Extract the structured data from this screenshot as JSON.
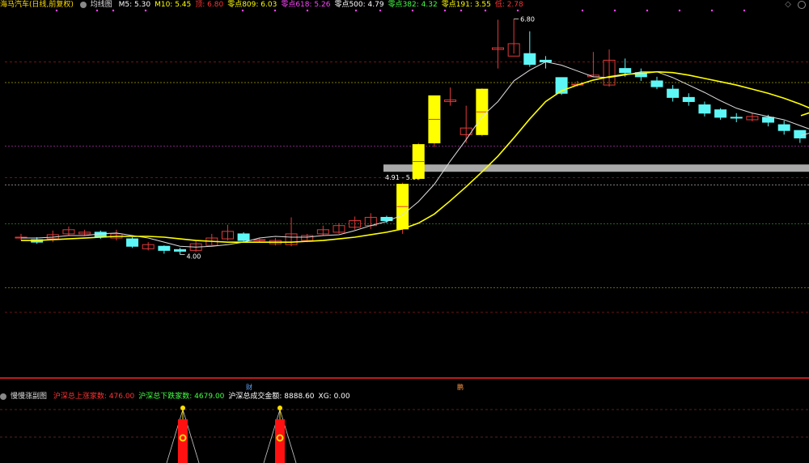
{
  "main_header": {
    "stock": "海马汽车(日线,前复权)",
    "indicator": "均线图",
    "items": [
      {
        "label": "M5: 5.30",
        "color": "#ffffff"
      },
      {
        "label": "M10: 5.45",
        "color": "#ffff00"
      },
      {
        "label": "顶: 6.80",
        "color": "#ff3333"
      },
      {
        "label": "零点809: 6.03",
        "color": "#ffff00"
      },
      {
        "label": "零点618: 5.26",
        "color": "#ff44ff"
      },
      {
        "label": "零点500: 4.79",
        "color": "#ffffff"
      },
      {
        "label": "零点382: 4.32",
        "color": "#44ff44"
      },
      {
        "label": "零点191: 3.55",
        "color": "#ffff00"
      },
      {
        "label": "低: 2.78",
        "color": "#ff3333"
      }
    ]
  },
  "sub_header": {
    "indicator": "慢慢涨副图",
    "items": [
      {
        "label": "沪深总上涨家数: 476.00",
        "color": "#ff3333"
      },
      {
        "label": "沪深总下跌家数: 4679.00",
        "color": "#44ff44"
      },
      {
        "label": "沪深总成交金额: 8888.60",
        "color": "#ffffff"
      },
      {
        "label": "XG: 0.00",
        "color": "#ffffff"
      }
    ]
  },
  "markers": [
    {
      "text": "财",
      "color": "#66aaff"
    },
    {
      "text": "鹏",
      "color": "#ff9944"
    }
  ],
  "chart_data": {
    "type": "candlestick",
    "y_range": [
      3.7,
      6.95
    ],
    "annotations": {
      "high": "6.80",
      "low": "4.00",
      "zone": "4.91 - 5.00"
    },
    "reference_levels": [
      {
        "name": "零点809",
        "value": 6.03,
        "color": "#ffff00"
      },
      {
        "name": "零点618",
        "value": 5.26,
        "color": "#ff44ff"
      },
      {
        "name": "零点500",
        "value": 4.79,
        "color": "#ffffff"
      },
      {
        "name": "零点382",
        "value": 4.32,
        "color": "#44ff44"
      },
      {
        "name": "零点191",
        "value": 3.55,
        "color": "#ffff00"
      }
    ],
    "zone": [
      4.91,
      5.0
    ],
    "candles": [
      [
        4.15,
        4.16,
        4.2,
        4.12
      ],
      [
        4.13,
        4.1,
        4.16,
        4.08
      ],
      [
        4.14,
        4.19,
        4.24,
        4.1
      ],
      [
        4.2,
        4.25,
        4.29,
        4.18
      ],
      [
        4.2,
        4.22,
        4.25,
        4.18
      ],
      [
        4.22,
        4.16,
        4.24,
        4.14
      ],
      [
        4.15,
        4.2,
        4.25,
        4.12
      ],
      [
        4.14,
        4.05,
        4.16,
        4.03
      ],
      [
        4.02,
        4.07,
        4.1,
        4.0
      ],
      [
        4.05,
        4.0,
        4.06,
        3.96
      ],
      [
        4.01,
        3.99,
        4.03,
        3.95
      ],
      [
        4.0,
        4.08,
        4.12,
        3.98
      ],
      [
        4.06,
        4.15,
        4.2,
        4.05
      ],
      [
        4.14,
        4.23,
        4.31,
        4.12
      ],
      [
        4.2,
        4.12,
        4.22,
        4.1
      ],
      [
        4.12,
        4.13,
        4.15,
        4.1
      ],
      [
        4.08,
        4.12,
        4.15,
        4.06
      ],
      [
        4.07,
        4.2,
        4.4,
        4.05
      ],
      [
        4.12,
        4.18,
        4.2,
        4.1
      ],
      [
        4.2,
        4.25,
        4.3,
        4.18
      ],
      [
        4.22,
        4.3,
        4.33,
        4.2
      ],
      [
        4.28,
        4.36,
        4.41,
        4.25
      ],
      [
        4.3,
        4.4,
        4.45,
        4.26
      ],
      [
        4.4,
        4.36,
        4.42,
        4.33
      ],
      [
        4.26,
        4.8,
        4.82,
        4.2
      ],
      [
        4.87,
        5.28,
        5.3,
        4.85
      ],
      [
        5.3,
        5.87,
        5.87,
        5.25
      ],
      [
        5.8,
        5.82,
        5.97,
        5.75
      ],
      [
        5.4,
        5.48,
        5.75,
        5.3
      ],
      [
        5.4,
        5.95,
        5.96,
        5.38
      ],
      [
        6.43,
        6.45,
        6.79,
        6.2
      ],
      [
        6.35,
        6.5,
        6.8,
        6.38
      ],
      [
        6.38,
        6.25,
        6.65,
        6.22
      ],
      [
        6.3,
        6.28,
        6.35,
        6.2
      ],
      [
        6.09,
        5.9,
        6.09,
        5.88
      ],
      [
        6.0,
        6.01,
        6.05,
        5.98
      ],
      [
        6.1,
        6.12,
        6.4,
        6.1
      ],
      [
        6.0,
        6.3,
        6.43,
        5.98
      ],
      [
        6.2,
        6.15,
        6.32,
        6.1
      ],
      [
        6.15,
        6.1,
        6.2,
        6.05
      ],
      [
        6.05,
        5.98,
        6.1,
        5.95
      ],
      [
        5.95,
        5.85,
        6.0,
        5.8
      ],
      [
        5.85,
        5.8,
        5.9,
        5.75
      ],
      [
        5.76,
        5.66,
        5.8,
        5.62
      ],
      [
        5.7,
        5.61,
        5.72,
        5.58
      ],
      [
        5.61,
        5.6,
        5.66,
        5.55
      ],
      [
        5.58,
        5.62,
        5.66,
        5.56
      ],
      [
        5.61,
        5.55,
        5.64,
        5.5
      ],
      [
        5.52,
        5.45,
        5.57,
        5.4
      ],
      [
        5.45,
        5.36,
        5.45,
        5.3
      ],
      [
        5.3,
        5.26,
        5.32,
        5.2
      ]
    ],
    "series": [
      {
        "name": "M5",
        "color": "#dddddd",
        "values": [
          4.15,
          4.15,
          4.16,
          4.18,
          4.18,
          4.2,
          4.21,
          4.18,
          4.15,
          4.1,
          4.05,
          4.04,
          4.05,
          4.07,
          4.1,
          4.15,
          4.17,
          4.16,
          4.16,
          4.18,
          4.19,
          4.24,
          4.3,
          4.35,
          4.43,
          4.59,
          4.8,
          5.08,
          5.34,
          5.62,
          5.8,
          6.05,
          6.18,
          6.28,
          6.24,
          6.17,
          6.1,
          6.09,
          6.12,
          6.16,
          6.16,
          6.09,
          6.0,
          5.91,
          5.81,
          5.72,
          5.66,
          5.62,
          5.58,
          5.51,
          5.44
        ]
      },
      {
        "name": "M10",
        "color": "#ffff00",
        "values": [
          4.12,
          4.12,
          4.13,
          4.14,
          4.15,
          4.16,
          4.17,
          4.17,
          4.17,
          4.16,
          4.14,
          4.12,
          4.11,
          4.1,
          4.1,
          4.1,
          4.1,
          4.1,
          4.11,
          4.12,
          4.14,
          4.16,
          4.19,
          4.22,
          4.26,
          4.33,
          4.44,
          4.6,
          4.77,
          4.95,
          5.14,
          5.36,
          5.59,
          5.8,
          5.93,
          6.0,
          6.06,
          6.1,
          6.13,
          6.14,
          6.16,
          6.15,
          6.12,
          6.08,
          6.04,
          6.0,
          5.95,
          5.9,
          5.84,
          5.77,
          5.69
        ]
      }
    ]
  }
}
